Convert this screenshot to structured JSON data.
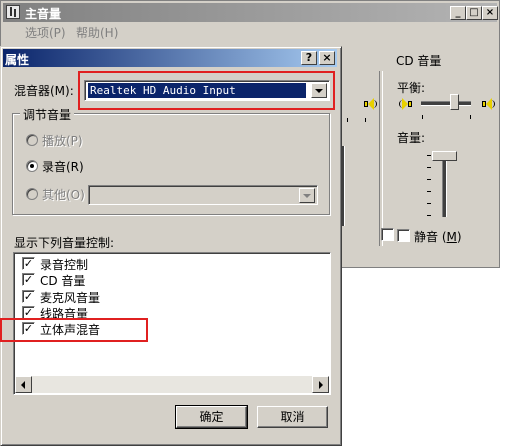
{
  "mixer": {
    "title": "主音量",
    "menu": [
      "选项(P)",
      "帮助(H)"
    ],
    "controls": {
      "minimize": "_",
      "maximize": "□",
      "close": "×"
    },
    "cd_channel": {
      "title": "CD 音量",
      "balance_label": "平衡:",
      "volume_label": "音量:",
      "mute_label": "静音",
      "mute_hotkey": "M",
      "mute_checked": false
    }
  },
  "dialog": {
    "title": "属性",
    "help_btn": "?",
    "close_btn": "×",
    "mixer_label": "混音器(M):",
    "mixer_value": "Realtek HD Audio Input",
    "adjust_group": "调节音量",
    "radios": [
      {
        "label": "播放(P)",
        "selected": false,
        "enabled": false
      },
      {
        "label": "录音(R)",
        "selected": true,
        "enabled": true
      },
      {
        "label": "其他(O)",
        "selected": false,
        "enabled": false
      }
    ],
    "list_label": "显示下列音量控制:",
    "list_items": [
      {
        "label": "录音控制",
        "checked": true
      },
      {
        "label": "CD 音量",
        "checked": true
      },
      {
        "label": "麦克风音量",
        "checked": true
      },
      {
        "label": "线路音量",
        "checked": true
      },
      {
        "label": "立体声混音",
        "checked": true
      }
    ],
    "ok": "确定",
    "cancel": "取消"
  },
  "colors": {
    "dialog_title_start": "#0a246a",
    "dialog_title_end": "#a6caf0",
    "inactive_title": "#808080",
    "highlight_box": "#e02020",
    "face": "#d4d0c8"
  }
}
